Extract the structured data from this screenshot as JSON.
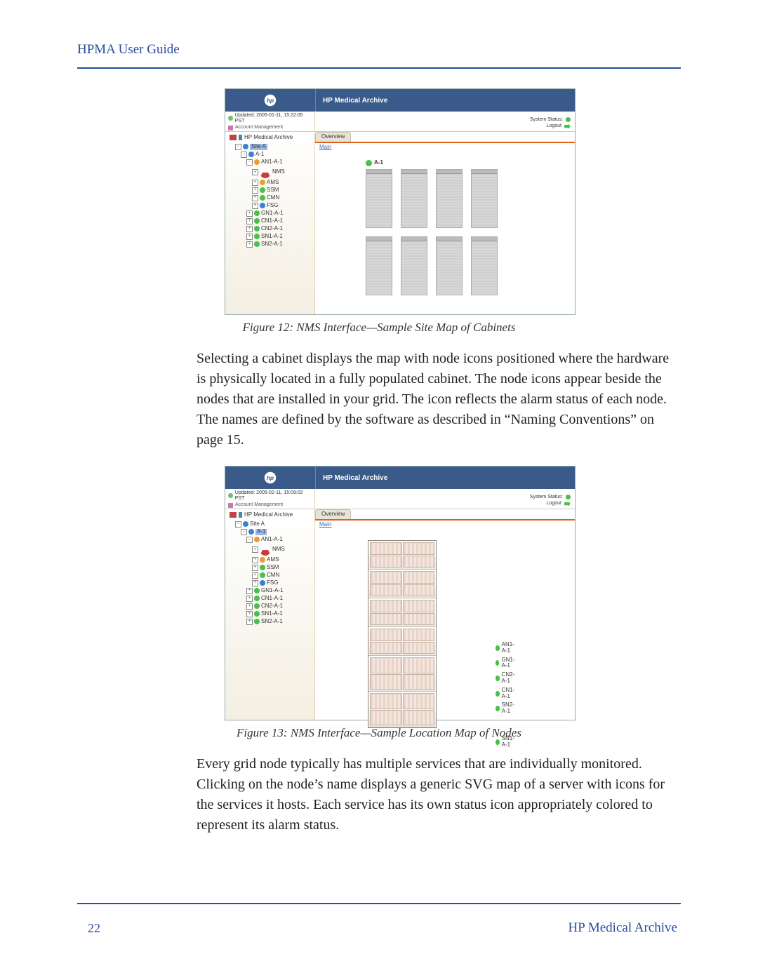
{
  "header": {
    "guide_title": "HPMA User Guide"
  },
  "figure12": {
    "caption": "Figure 12: NMS Interface—Sample Site Map of Cabinets",
    "app": {
      "title": "HP Medical Archive",
      "updated": "Updated: 2005-01-11, 15:22:05 PST",
      "account_mgmt": "Account Management",
      "system_status": "System Status:",
      "logout": "Logout",
      "overview_tab": "Overview",
      "main_link": "Main",
      "tree_root": "HP Medical Archive",
      "tree": {
        "site": "Site A",
        "cabinet": "A-1",
        "an": "AN1-A-1",
        "services": [
          "NMS",
          "AMS",
          "SSM",
          "CMN",
          "FSG"
        ],
        "nodes": [
          "GN1-A-1",
          "CN1-A-1",
          "CN2-A-1",
          "SN1-A-1",
          "SN2-A-1"
        ]
      },
      "selected": "Site A",
      "cab_map_label": "A-1"
    }
  },
  "paragraph1": "Selecting a cabinet displays the map with node icons positioned where the hardware is physically located in a fully populated cabinet. The node icons appear beside the nodes that are installed in your grid. The icon reflects the alarm status of each node. The names are defined by the software as described in “Naming Conventions” on page 15.",
  "figure13": {
    "caption": "Figure 13: NMS Interface—Sample Location Map of Nodes",
    "app": {
      "title": "HP Medical Archive",
      "updated": "Updated: 2005-02-11, 15:09:02 PST",
      "account_mgmt": "Account Management",
      "system_status": "System Status:",
      "logout": "Logout",
      "overview_tab": "Overview",
      "main_link": "Main",
      "tree_root": "HP Medical Archive",
      "tree": {
        "site": "Site A",
        "cabinet": "A-1",
        "an": "AN1-A-1",
        "services": [
          "NMS",
          "AMS",
          "SSM",
          "CMN",
          "FSG"
        ],
        "nodes": [
          "GN1-A-1",
          "CN1-A-1",
          "CN2-A-1",
          "SN1-A-1",
          "SN2-A-1"
        ]
      },
      "selected": "A-1",
      "node_labels": [
        "AN1-A-1",
        "GN1-A-1",
        "CN2-A-1",
        "CN1-A-1",
        "SN2-A-1",
        "SN1-A-1"
      ]
    }
  },
  "paragraph2": "Every grid node typically has multiple services that are individually monitored. Clicking on the node’s name displays a generic SVG map of a server with icons for the services it hosts. Each service has its own status icon appropriately colored to represent its alarm status.",
  "footer": {
    "page_number": "22",
    "brand": "HP Medical Archive"
  }
}
